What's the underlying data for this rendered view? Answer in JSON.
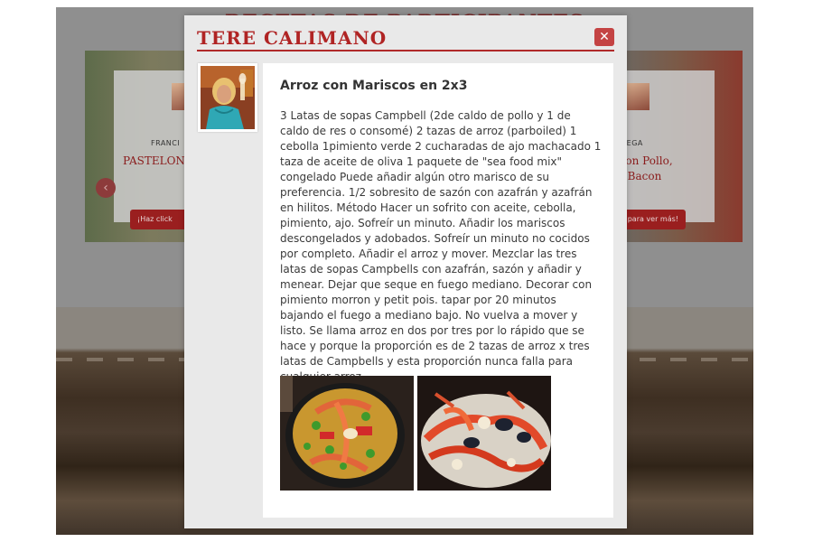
{
  "background": {
    "heading": "RECETAS DE PARTICIPANTES",
    "cards": [
      {
        "author": "FRANCI",
        "title": "PASTELON",
        "button": "¡Haz click"
      },
      {
        "author": "A ORTEGA",
        "title_line1": "da con Pollo,",
        "title_line2": "es y Bacon",
        "button": "para ver más!"
      }
    ],
    "prev_arrow": "‹",
    "next_arrow": "›"
  },
  "modal": {
    "author_name": "TERE CALIMANO",
    "close_label": "✕",
    "recipe": {
      "title": "Arroz con Mariscos en 2x3",
      "body": "3 Latas de sopas Campbell (2de caldo de pollo y 1 de caldo de res o consomé) 2 tazas de arroz (parboiled) 1 cebolla 1pimiento verde 2 cucharadas de ajo machacado 1 taza de aceite de oliva 1 paquete de \"sea food mix\" congelado Puede añadir algún otro marisco de su preferencia. 1/2 sobresito de sazón con azafrán y azafrán en hilitos. Método Hacer un sofrito con aceite, cebolla, pimiento, ajo. Sofreír un minuto. Añadir los mariscos descongelados y adobados. Sofreír un minuto no cocidos por completo. Añadir el arroz y mover. Mezclar las tres latas de sopas Campbells con azafrán, sazón y añadir y menear. Dejar que seque en fuego mediano. Decorar con pimiento morron y petit pois. tapar por 20 minutos bajando el fuego a mediano bajo. No vuelva a mover y listo. Se llama arroz en dos por tres por lo rápido que se hace y porque la proporción es de 2 tazas de arroz x tres latas de Campbells y esta proporción nunca falla para cualquier arroz."
    }
  },
  "colors": {
    "accent": "#b02424",
    "close_button": "#c44343"
  }
}
